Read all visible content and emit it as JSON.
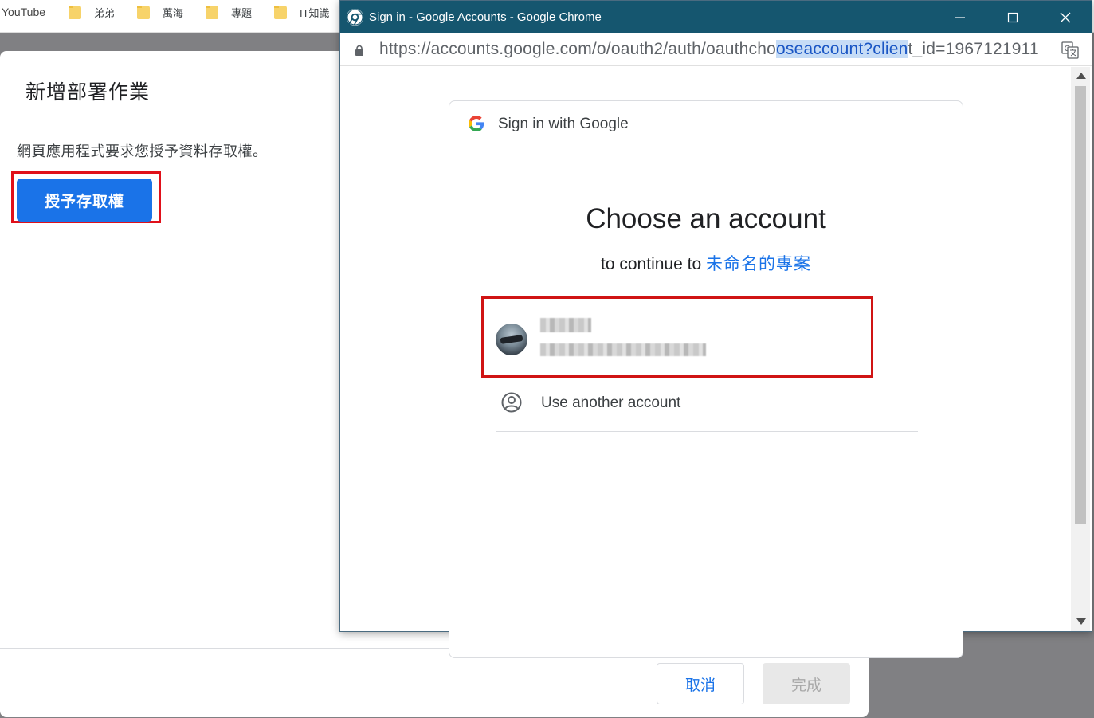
{
  "bookmarks": [
    {
      "label": "YouTube",
      "folder": false
    },
    {
      "label": "弟弟",
      "folder": true
    },
    {
      "label": "萬海",
      "folder": true
    },
    {
      "label": "專題",
      "folder": true
    },
    {
      "label": "IT知識",
      "folder": true
    }
  ],
  "deploy_dialog": {
    "title": "新增部署作業",
    "message": "網頁應用程式要求您授予資料存取權。",
    "grant_button": "授予存取權",
    "cancel_button": "取消",
    "done_button": "完成"
  },
  "popup": {
    "window_title": "Sign in - Google Accounts - Google Chrome",
    "url_before": "https://accounts.google.com/o/oauth2/auth/oauthcho",
    "url_selected": "oseaccount?clien",
    "url_after": "t_id=1967121911",
    "card_header": "Sign in with Google",
    "heading": "Choose an account",
    "continue_prefix": "to continue to ",
    "project_name": "未命名的專案",
    "another_account": "Use another account"
  },
  "colors": {
    "titlebar": "#15566f",
    "primary_blue": "#1a73e8",
    "highlight_red": "#e0101a"
  },
  "icons": [
    "chrome-logo-icon",
    "lock-icon",
    "translate-icon",
    "google-g-icon",
    "person-circle-icon",
    "folder-icon",
    "minimize-icon",
    "maximize-icon",
    "close-icon"
  ]
}
